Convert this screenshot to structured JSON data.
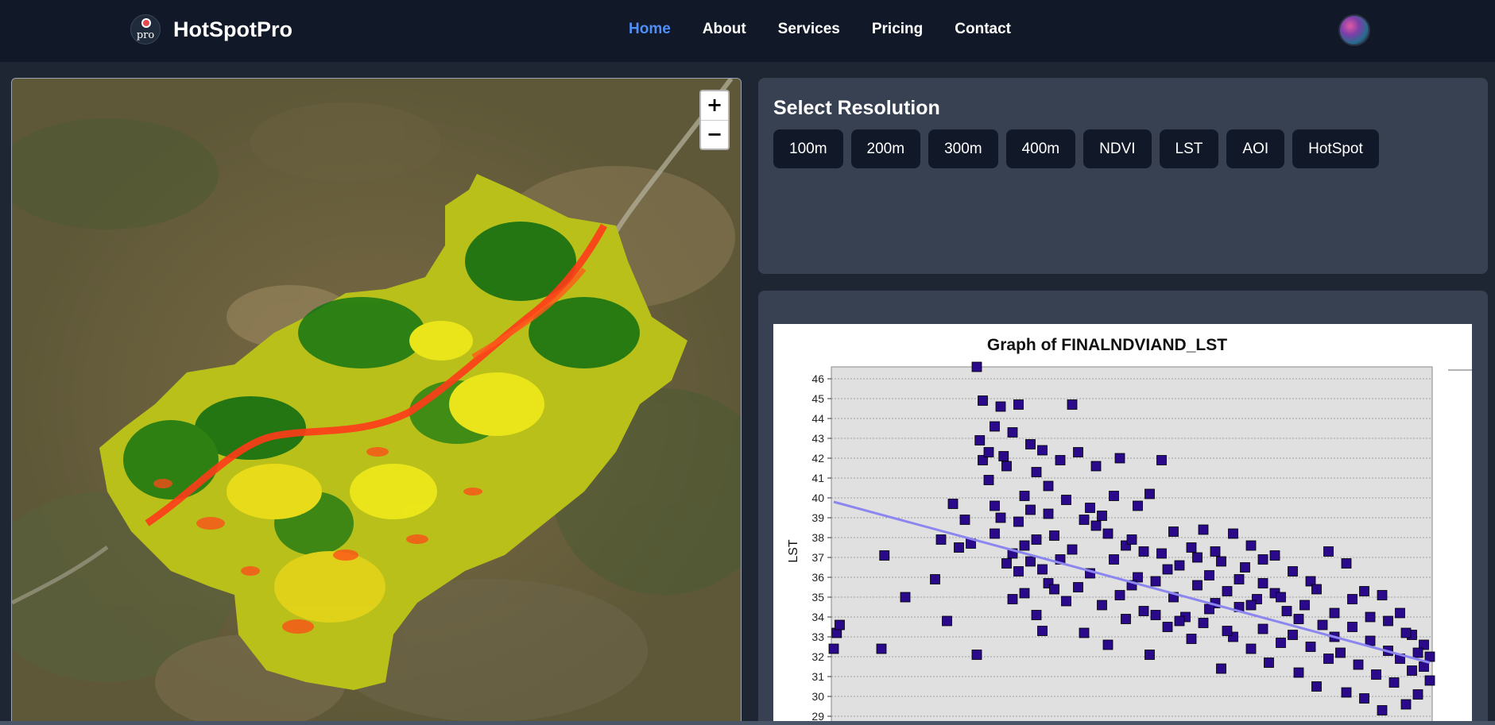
{
  "app": {
    "name": "HotSpotPro",
    "logo_text": "pro",
    "logo_icon": "globe-logo-icon",
    "avatar_icon": "user-avatar-icon"
  },
  "nav": {
    "items": [
      {
        "label": "Home",
        "active": true
      },
      {
        "label": "About",
        "active": false
      },
      {
        "label": "Services",
        "active": false
      },
      {
        "label": "Pricing",
        "active": false
      },
      {
        "label": "Contact",
        "active": false
      }
    ],
    "active_color": "#4f8ef7"
  },
  "map": {
    "zoom_in": "+",
    "zoom_out": "−",
    "legend_colors": {
      "high": "#ff3b1a",
      "mid": "#f2ec1a",
      "low": "#0a6a10"
    }
  },
  "resolution": {
    "title": "Select Resolution",
    "buttons": [
      "100m",
      "200m",
      "300m",
      "400m",
      "NDVI",
      "LST",
      "AOI",
      "HotSpot"
    ]
  },
  "chart_data": {
    "type": "scatter",
    "title": "Graph of FINALNDVIAND_LST",
    "ylabel": "LST",
    "xlabel": "",
    "ylim": [
      29,
      46.5
    ],
    "yticks": [
      29,
      30,
      31,
      32,
      33,
      34,
      35,
      36,
      37,
      38,
      39,
      40,
      41,
      42,
      43,
      44,
      45,
      46
    ],
    "xlim": [
      0,
      100
    ],
    "grid": true,
    "marker_color": "#2a0a8a",
    "trendline_color": "#8c86f0",
    "trendline": [
      [
        0,
        39.8
      ],
      [
        100,
        31.7
      ]
    ],
    "points": [
      [
        0,
        32.4
      ],
      [
        0.5,
        33.2
      ],
      [
        1,
        33.6
      ],
      [
        8,
        32.4
      ],
      [
        8.5,
        37.1
      ],
      [
        12,
        35.0
      ],
      [
        17,
        35.9
      ],
      [
        18,
        37.9
      ],
      [
        19,
        33.8
      ],
      [
        20,
        39.7
      ],
      [
        21,
        37.5
      ],
      [
        22,
        38.9
      ],
      [
        23,
        37.7
      ],
      [
        24,
        32.1
      ],
      [
        24,
        46.6
      ],
      [
        24.5,
        42.9
      ],
      [
        25,
        41.9
      ],
      [
        25,
        44.9
      ],
      [
        26,
        40.9
      ],
      [
        26,
        42.3
      ],
      [
        27,
        39.6
      ],
      [
        27,
        43.6
      ],
      [
        28,
        44.6
      ],
      [
        28.5,
        42.1
      ],
      [
        29,
        41.6
      ],
      [
        30,
        43.3
      ],
      [
        31,
        44.7
      ],
      [
        32,
        40.1
      ],
      [
        33,
        42.7
      ],
      [
        34,
        41.3
      ],
      [
        35,
        42.4
      ],
      [
        36,
        40.6
      ],
      [
        38,
        41.9
      ],
      [
        39,
        39.9
      ],
      [
        40,
        44.7
      ],
      [
        41,
        42.3
      ],
      [
        42,
        38.9
      ],
      [
        44,
        41.6
      ],
      [
        45,
        39.1
      ],
      [
        47,
        40.1
      ],
      [
        48,
        42.0
      ],
      [
        49,
        37.6
      ],
      [
        51,
        39.6
      ],
      [
        53,
        40.2
      ],
      [
        55,
        41.9
      ],
      [
        57,
        38.3
      ],
      [
        60,
        37.5
      ],
      [
        62,
        38.4
      ],
      [
        64,
        37.3
      ],
      [
        67,
        38.2
      ],
      [
        70,
        37.6
      ],
      [
        72,
        36.9
      ],
      [
        74,
        37.1
      ],
      [
        77,
        36.3
      ],
      [
        80,
        35.8
      ],
      [
        83,
        37.3
      ],
      [
        86,
        36.7
      ],
      [
        89,
        35.3
      ],
      [
        92,
        35.1
      ],
      [
        95,
        34.2
      ],
      [
        97,
        33.1
      ],
      [
        99,
        31.5
      ],
      [
        100,
        30.8
      ],
      [
        30,
        37.2
      ],
      [
        31,
        36.3
      ],
      [
        32,
        35.2
      ],
      [
        33,
        36.8
      ],
      [
        34,
        34.1
      ],
      [
        35,
        33.3
      ],
      [
        36,
        35.7
      ],
      [
        37,
        38.1
      ],
      [
        38,
        36.9
      ],
      [
        39,
        34.8
      ],
      [
        40,
        37.4
      ],
      [
        41,
        35.5
      ],
      [
        42,
        33.2
      ],
      [
        43,
        36.2
      ],
      [
        44,
        38.6
      ],
      [
        45,
        34.6
      ],
      [
        46,
        32.6
      ],
      [
        47,
        36.9
      ],
      [
        48,
        35.1
      ],
      [
        49,
        33.9
      ],
      [
        50,
        37.9
      ],
      [
        51,
        36.0
      ],
      [
        52,
        34.3
      ],
      [
        53,
        32.1
      ],
      [
        54,
        35.8
      ],
      [
        55,
        37.2
      ],
      [
        56,
        33.5
      ],
      [
        57,
        35.0
      ],
      [
        58,
        36.6
      ],
      [
        59,
        34.0
      ],
      [
        60,
        32.9
      ],
      [
        61,
        35.6
      ],
      [
        62,
        33.7
      ],
      [
        63,
        36.1
      ],
      [
        64,
        34.7
      ],
      [
        65,
        31.4
      ],
      [
        66,
        35.3
      ],
      [
        67,
        33.0
      ],
      [
        68,
        34.5
      ],
      [
        69,
        36.5
      ],
      [
        70,
        32.4
      ],
      [
        71,
        34.9
      ],
      [
        72,
        33.4
      ],
      [
        73,
        31.7
      ],
      [
        74,
        35.2
      ],
      [
        75,
        32.7
      ],
      [
        76,
        34.3
      ],
      [
        77,
        33.1
      ],
      [
        78,
        31.2
      ],
      [
        79,
        34.6
      ],
      [
        80,
        32.5
      ],
      [
        81,
        30.5
      ],
      [
        82,
        33.6
      ],
      [
        83,
        31.9
      ],
      [
        84,
        34.2
      ],
      [
        85,
        32.2
      ],
      [
        86,
        30.2
      ],
      [
        87,
        33.5
      ],
      [
        88,
        31.6
      ],
      [
        89,
        29.9
      ],
      [
        90,
        32.8
      ],
      [
        91,
        31.1
      ],
      [
        92,
        29.3
      ],
      [
        93,
        32.3
      ],
      [
        94,
        30.7
      ],
      [
        95,
        31.9
      ],
      [
        96,
        29.6
      ],
      [
        97,
        31.3
      ],
      [
        98,
        30.1
      ],
      [
        99,
        32.6
      ],
      [
        27,
        38.2
      ],
      [
        28,
        39.0
      ],
      [
        29,
        36.7
      ],
      [
        30,
        34.9
      ],
      [
        31,
        38.8
      ],
      [
        32,
        37.6
      ],
      [
        33,
        39.4
      ],
      [
        34,
        37.9
      ],
      [
        35,
        36.4
      ],
      [
        36,
        39.2
      ],
      [
        37,
        35.4
      ],
      [
        43,
        39.5
      ],
      [
        46,
        38.2
      ],
      [
        50,
        35.6
      ],
      [
        52,
        37.3
      ],
      [
        54,
        34.1
      ],
      [
        56,
        36.4
      ],
      [
        58,
        33.8
      ],
      [
        61,
        37.0
      ],
      [
        63,
        34.4
      ],
      [
        65,
        36.8
      ],
      [
        66,
        33.3
      ],
      [
        68,
        35.9
      ],
      [
        70,
        34.6
      ],
      [
        72,
        35.7
      ],
      [
        75,
        35.0
      ],
      [
        78,
        33.9
      ],
      [
        81,
        35.4
      ],
      [
        84,
        33.0
      ],
      [
        87,
        34.9
      ],
      [
        90,
        34.0
      ],
      [
        93,
        33.8
      ],
      [
        96,
        33.2
      ],
      [
        98,
        32.2
      ],
      [
        100,
        32.0
      ]
    ]
  }
}
